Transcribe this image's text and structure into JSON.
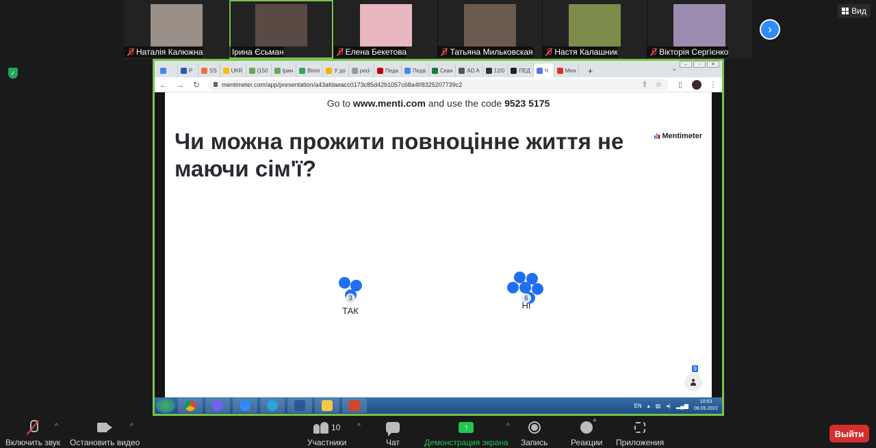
{
  "participants": [
    {
      "name": "Наталія Калюжна",
      "muted": true,
      "color": "#9a8f86"
    },
    {
      "name": "Ірина Єсьман",
      "muted": false,
      "color": "#5a4a44",
      "active": true
    },
    {
      "name": "Елена Бекетова",
      "muted": true,
      "color": "#e9b7bf"
    },
    {
      "name": "Татьяна Мильковская",
      "muted": true,
      "color": "#6b5a50"
    },
    {
      "name": "Настя Калашник",
      "muted": true,
      "color": "#7c8a4a"
    },
    {
      "name": "Вікторія Сергієнко",
      "muted": true,
      "color": "#9c8cb0"
    }
  ],
  "view_label": "Вид",
  "browser": {
    "tabs": [
      "",
      "P",
      "SS",
      "UKR",
      "(150",
      "Ірин",
      "Biom",
      "У до",
      "ped-",
      "Педа",
      "Педа",
      "Скан",
      "AD A",
      "12/0",
      "ПЕД",
      "Ч",
      "Мен"
    ],
    "tab_colors": [
      "#4a86e8",
      "#2b5ba8",
      "#e8743b",
      "#f4c20d",
      "#6aa84f",
      "#6aa84f",
      "#34a853",
      "#f4b400",
      "#999999",
      "#c00000",
      "#4a86e8",
      "#1e7b34",
      "#555555",
      "#333333",
      "#222222",
      "#4b7bec",
      "#d93025"
    ],
    "active_tab_index": 15,
    "url": "mentimeter.com/app/presentation/a43afdaeacc0173c85d42b1057c68a4f/8325207739c2"
  },
  "slide": {
    "join_prefix": "Go to",
    "join_site": "www.menti.com",
    "join_mid": "and use the code",
    "join_code": "9523 5175",
    "question": "Чи можна прожити повноцінне життя не маючи сім'ї?",
    "brand": "Mentimeter",
    "options": [
      {
        "label": "ТАК",
        "votes": "3"
      },
      {
        "label": "НІ",
        "votes": "6"
      }
    ],
    "voters_count": "9",
    "accent": "#1e6ff1"
  },
  "taskbar": {
    "lang": "EN",
    "time": "10:53",
    "date": "06.05.2022"
  },
  "toolbar": {
    "mic_label": "Включить звук",
    "video_label": "Остановить видео",
    "participants_label": "Участники",
    "participants_count": "10",
    "chat_label": "Чат",
    "share_label": "Демонстрация экрана",
    "record_label": "Запись",
    "reactions_label": "Реакции",
    "apps_label": "Приложения",
    "leave_label": "Выйти"
  }
}
